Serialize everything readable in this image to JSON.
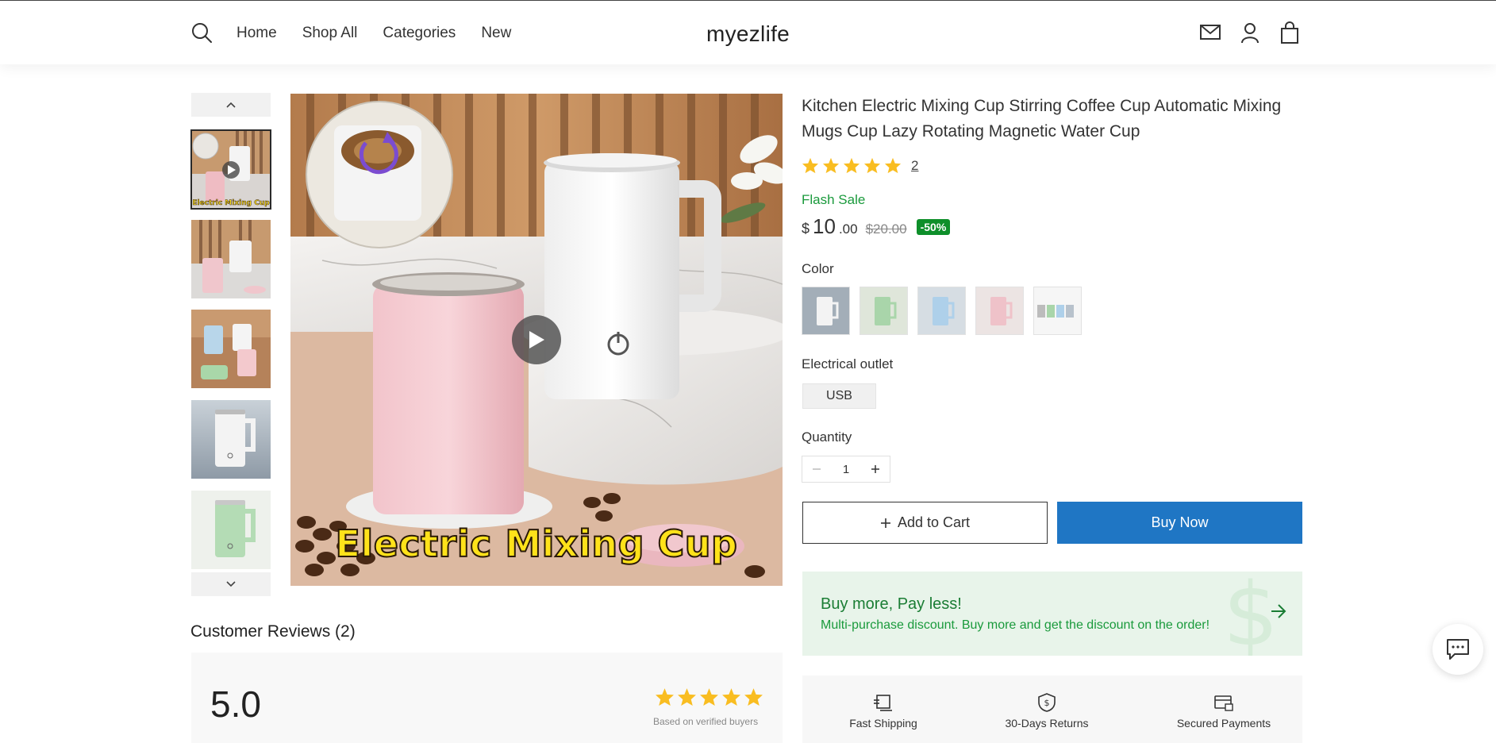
{
  "header": {
    "logo": "myezlife",
    "nav": [
      "Home",
      "Shop All",
      "Categories",
      "New"
    ],
    "icons": [
      "search-icon",
      "mail-icon",
      "user-icon",
      "bag-icon"
    ]
  },
  "gallery": {
    "thumbnails": [
      "thumb-video",
      "thumb-pink-white",
      "thumb-blue-white-pink",
      "thumb-white",
      "thumb-green"
    ],
    "active_index": 0,
    "main_caption": "Electric Mixing Cup",
    "thumb_caption": "Electric Mixing Cup"
  },
  "product": {
    "title": "Kitchen Electric Mixing Cup Stirring Coffee Cup Automatic Mixing Mugs Cup Lazy Rotating Magnetic Water Cup",
    "rating": 5,
    "review_count": "2",
    "flash_label": "Flash Sale",
    "price": {
      "currency": "$",
      "integer": "10",
      "decimal": ".00",
      "original": "$20.00",
      "discount": "-50%"
    },
    "color_label": "Color",
    "colors": [
      "white",
      "green",
      "blue",
      "pink",
      "all"
    ],
    "outlet_label": "Electrical outlet",
    "outlet_option": "USB",
    "quantity_label": "Quantity",
    "quantity": "1",
    "add_to_cart": "Add to Cart",
    "buy_now": "Buy Now"
  },
  "promo": {
    "title": "Buy more, Pay less!",
    "subtitle": "Multi-purchase discount. Buy more and get the discount on the order!"
  },
  "features": [
    "Fast Shipping",
    "30-Days Returns",
    "Secured Payments"
  ],
  "reviews": {
    "title": "Customer Reviews (2)",
    "score": "5.0",
    "note": "Based on verified buyers"
  },
  "colors": {
    "accent_blue": "#1f76c4",
    "sale_green": "#1a9a3c",
    "badge_green": "#0e8f2a",
    "star_yellow": "#f9bd21",
    "promo_bg": "#e8f4ea"
  }
}
